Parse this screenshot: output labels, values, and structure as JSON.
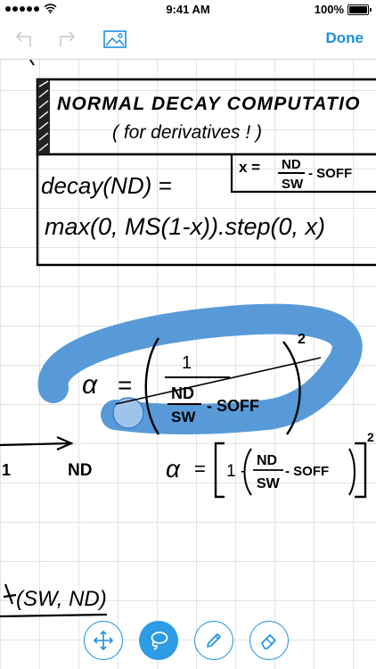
{
  "status_bar": {
    "time": "9:41 AM",
    "battery": "100%",
    "signal_dots": 5
  },
  "toolbar": {
    "done_label": "Done",
    "undo_icon": "undo-arrow-icon",
    "redo_icon": "redo-arrow-icon",
    "image_icon": "image-icon"
  },
  "colors": {
    "accent": "#1a8fe3",
    "lasso_highlight": "#4f95d6",
    "ink": "#000000",
    "grid": "#e3e3e3"
  },
  "tools": [
    {
      "id": "move",
      "icon": "move-arrows-icon",
      "active": false
    },
    {
      "id": "lasso",
      "icon": "lasso-icon",
      "active": true
    },
    {
      "id": "pen",
      "icon": "pencil-icon",
      "active": false
    },
    {
      "id": "eraser",
      "icon": "eraser-icon",
      "active": false
    }
  ],
  "note": {
    "box_title_line1": "NORMAL DECAY COMPUTATIO",
    "box_title_line2": "( for derivatives ! )",
    "decay_lhs": "decay(ND) =",
    "x_def_left": "x =",
    "x_def_num": "ND",
    "x_def_den": "SW",
    "x_def_right": "- SOFF",
    "decay_rhs": "max(0, MS(1-x)).step(0, x)",
    "alpha_symbol": "α",
    "eq": "=",
    "alpha1_num": "1",
    "alpha1_den_num": "ND",
    "alpha1_den_den": "SW",
    "alpha1_den_right": "- SOFF",
    "alpha1_exp": "2",
    "axis_start_label": "1",
    "axis_label": "ND",
    "alpha2_one": "1 -",
    "alpha2_num": "ND",
    "alpha2_den": "SW",
    "alpha2_right": "- SOFF",
    "alpha2_exp": "2",
    "bottom_fragment": "(SW, ND)"
  }
}
